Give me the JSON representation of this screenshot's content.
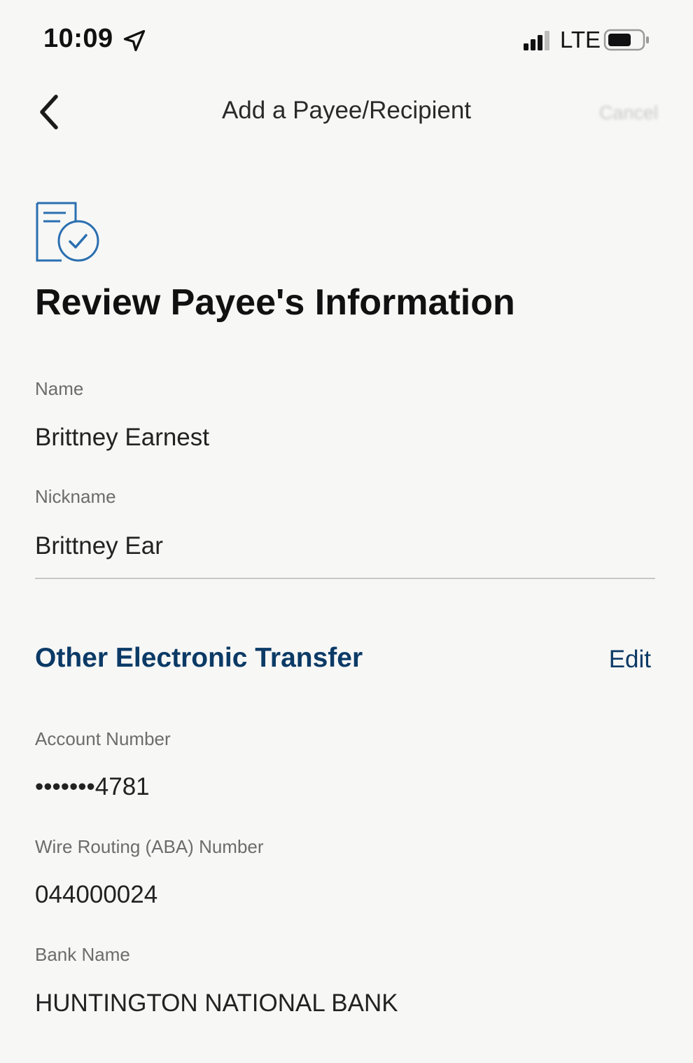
{
  "status_bar": {
    "time": "10:09",
    "network": "LTE",
    "icons": [
      "location-arrow-icon",
      "signal-icon",
      "battery-icon"
    ]
  },
  "nav": {
    "title": "Add a Payee/Recipient",
    "back_icon": "chevron-left-icon",
    "cancel_label": "Cancel"
  },
  "review": {
    "icon": "document-check-icon",
    "title": "Review Payee's Information"
  },
  "payee": {
    "name_label": "Name",
    "name_value": "Brittney Earnest",
    "nickname_label": "Nickname",
    "nickname_value": "Brittney Ear"
  },
  "transfer": {
    "section_title": "Other Electronic Transfer",
    "edit_label": "Edit",
    "account_label": "Account Number",
    "account_value": "•••••••4781",
    "routing_label": "Wire Routing (ABA) Number",
    "routing_value": "044000024",
    "bank_label": "Bank Name",
    "bank_value": "HUNTINGTON NATIONAL BANK"
  },
  "colors": {
    "accent": "#0b3a66",
    "icon_blue": "#2a6fb0",
    "background": "#f7f7f6"
  }
}
